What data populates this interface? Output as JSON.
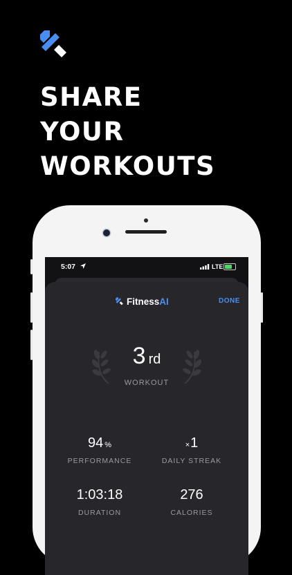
{
  "headline": {
    "lines": [
      "SHARE",
      "YOUR",
      "WORKOUTS"
    ]
  },
  "colors": {
    "background": "#000000",
    "accent": "#4A8DF0",
    "card": "#27272B",
    "muted_text": "#9A9AA0"
  },
  "status_bar": {
    "time": "5:07",
    "network": "LTE",
    "icons": [
      "location-arrow-icon",
      "signal-bars-icon",
      "battery-charging-icon"
    ]
  },
  "app": {
    "brand_main": "Fitness",
    "brand_accent": "AI",
    "done_label": "DONE"
  },
  "rank": {
    "number": "3",
    "suffix": "rd",
    "label": "WORKOUT"
  },
  "stats": [
    {
      "value": "94",
      "unit": "%",
      "label": "PERFORMANCE"
    },
    {
      "prefix": "×",
      "value": "1",
      "label": "DAILY STREAK"
    },
    {
      "value": "1:03:18",
      "label": "DURATION"
    },
    {
      "value": "276",
      "label": "CALORIES"
    }
  ]
}
